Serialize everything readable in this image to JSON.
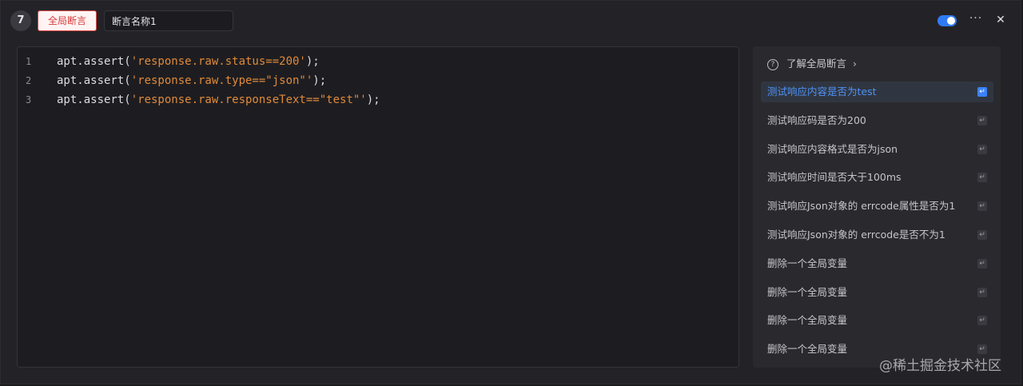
{
  "header": {
    "step_number": "7",
    "tag_label": "全局断言",
    "name_value": "断言名称1",
    "toggle_on": true,
    "more_label": "···",
    "close_label": "✕"
  },
  "editor": {
    "lines": [
      {
        "num": "1",
        "pre": "apt.assert(",
        "str": "'response.raw.status==200'",
        "post": ");"
      },
      {
        "num": "2",
        "pre": "apt.assert(",
        "str": "'response.raw.type==\"json\"'",
        "post": ");"
      },
      {
        "num": "3",
        "pre": "apt.assert(",
        "str": "'response.raw.responseText==\"test\"'",
        "post": ");"
      }
    ]
  },
  "panel": {
    "title": "了解全局断言",
    "chevron": "›",
    "snippets": [
      {
        "label": "测试响应内容是否为test",
        "active": true
      },
      {
        "label": "测试响应码是否为200",
        "active": false
      },
      {
        "label": "测试响应内容格式是否为json",
        "active": false
      },
      {
        "label": "测试响应时间是否大于100ms",
        "active": false
      },
      {
        "label": "测试响应Json对象的 errcode属性是否为1",
        "active": false
      },
      {
        "label": "测试响应Json对象的 errcode是否不为1",
        "active": false
      },
      {
        "label": "删除一个全局变量",
        "active": false
      },
      {
        "label": "删除一个全局变量",
        "active": false
      },
      {
        "label": "删除一个全局变量",
        "active": false
      },
      {
        "label": "删除一个全局变量",
        "active": false
      }
    ],
    "enter_glyph": "↵"
  },
  "watermark": "@稀土掘金技术社区"
}
